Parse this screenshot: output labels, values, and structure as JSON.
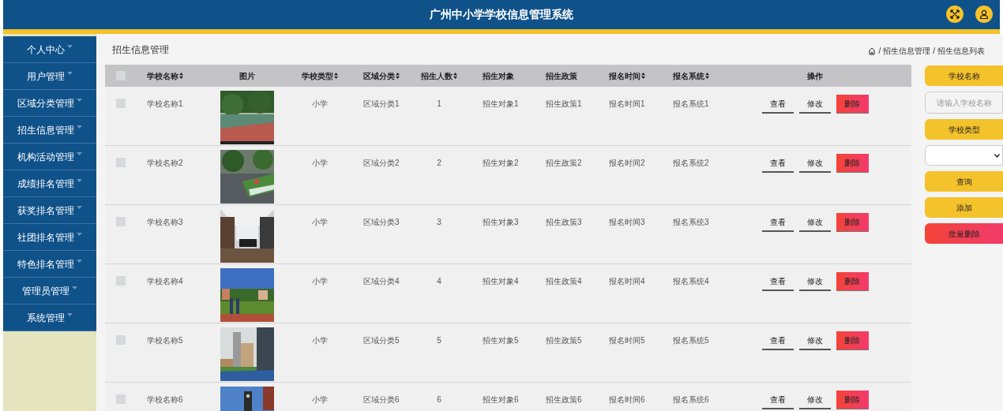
{
  "header": {
    "title": "广州中小学学校信息管理系统"
  },
  "sidebar": {
    "items": [
      {
        "label": "个人中心"
      },
      {
        "label": "用户管理"
      },
      {
        "label": "区域分类管理"
      },
      {
        "label": "招生信息管理"
      },
      {
        "label": "机构活动管理"
      },
      {
        "label": "成绩排名管理"
      },
      {
        "label": "获奖排名管理"
      },
      {
        "label": "社团排名管理"
      },
      {
        "label": "特色排名管理"
      },
      {
        "label": "管理员管理"
      },
      {
        "label": "系统管理"
      }
    ]
  },
  "page_title": "招生信息管理",
  "breadcrumb": [
    "/",
    "招生信息管理",
    "/",
    "招生信息列表"
  ],
  "table": {
    "select_all": {
      "checked": false
    },
    "columns": [
      {
        "label": "学校名称",
        "sortable": true
      },
      {
        "label": "图片",
        "sortable": false
      },
      {
        "label": "学校类型",
        "sortable": true
      },
      {
        "label": "区域分类",
        "sortable": true
      },
      {
        "label": "招生人数",
        "sortable": true
      },
      {
        "label": "招生对象",
        "sortable": false
      },
      {
        "label": "招生政策",
        "sortable": false
      },
      {
        "label": "报名时间",
        "sortable": true
      },
      {
        "label": "报名系统",
        "sortable": true
      },
      {
        "label": "操作",
        "sortable": false
      }
    ],
    "rows": [
      {
        "checked": false,
        "name": "学校名称1",
        "image": {
          "kind": "picture"
        },
        "type": "小学",
        "area": "区域分类1",
        "count": "1",
        "target": "招生对象1",
        "policy": "招生政策1",
        "time": "报名时间1",
        "system": "报名系统1",
        "actions": [
          "查看",
          "修改",
          "删除"
        ]
      },
      {
        "checked": false,
        "name": "学校名称2",
        "image": {
          "kind": "picture"
        },
        "type": "小学",
        "area": "区域分类2",
        "count": "2",
        "target": "招生对象2",
        "policy": "招生政策2",
        "time": "报名时间2",
        "system": "报名系统2",
        "actions": [
          "查看",
          "修改",
          "删除"
        ]
      },
      {
        "checked": false,
        "name": "学校名称3",
        "image": {
          "kind": "picture"
        },
        "type": "小学",
        "area": "区域分类3",
        "count": "3",
        "target": "招生对象3",
        "policy": "招生政策3",
        "time": "报名时间3",
        "system": "报名系统3",
        "actions": [
          "查看",
          "修改",
          "删除"
        ]
      },
      {
        "checked": false,
        "name": "学校名称4",
        "image": {
          "kind": "picture"
        },
        "type": "小学",
        "area": "区域分类4",
        "count": "4",
        "target": "招生对象4",
        "policy": "招生政策4",
        "time": "报名时间4",
        "system": "报名系统4",
        "actions": [
          "查看",
          "修改",
          "删除"
        ]
      },
      {
        "checked": false,
        "name": "学校名称5",
        "image": {
          "kind": "picture"
        },
        "type": "小学",
        "area": "区域分类5",
        "count": "5",
        "target": "招生对象5",
        "policy": "招生政策5",
        "time": "报名时间5",
        "system": "报名系统5",
        "actions": [
          "查看",
          "修改",
          "删除"
        ]
      },
      {
        "checked": false,
        "name": "学校名称6",
        "image": {
          "kind": "picture"
        },
        "type": "小学",
        "area": "区域分类6",
        "count": "6",
        "target": "招生对象6",
        "policy": "招生政策6",
        "time": "报名时间6",
        "system": "报名系统6",
        "actions": [
          "查看",
          "修改",
          "删除"
        ]
      }
    ]
  },
  "search_panel": {
    "name_label": "学校名称",
    "name_placeholder": "请输入学校名称",
    "type_label": "学校类型",
    "buttons": [
      {
        "label": "查询",
        "kind": "primary"
      },
      {
        "label": "添加",
        "kind": "primary"
      },
      {
        "label": "批量删除",
        "kind": "danger"
      }
    ]
  }
}
